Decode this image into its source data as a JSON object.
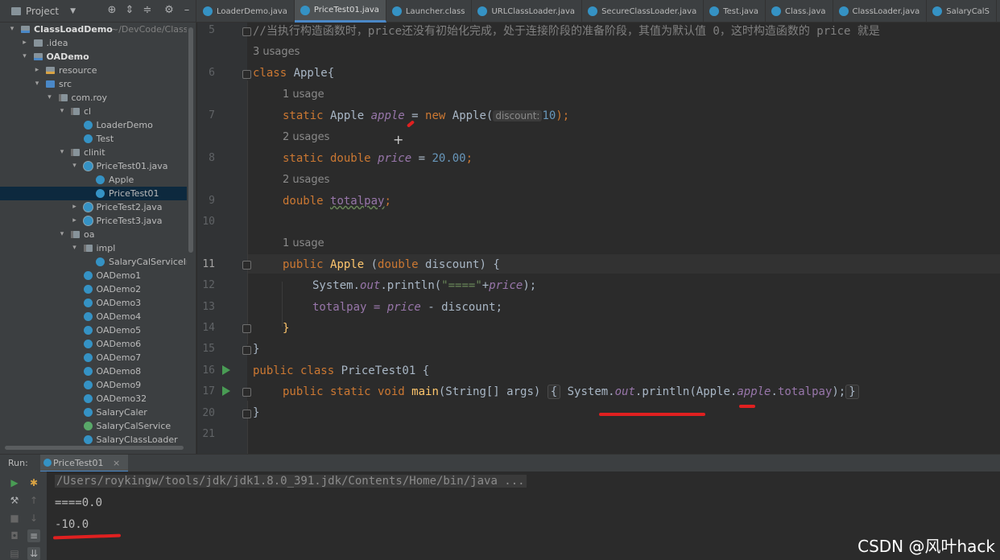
{
  "project_header": {
    "title": "Project",
    "icons": [
      "target-icon",
      "expand-icon",
      "collapse-icon",
      "gear-icon",
      "minimize-icon"
    ]
  },
  "tabs": [
    {
      "label": "LoaderDemo.java",
      "active": false
    },
    {
      "label": "PriceTest01.java",
      "active": true
    },
    {
      "label": "Launcher.class",
      "active": false
    },
    {
      "label": "URLClassLoader.java",
      "active": false
    },
    {
      "label": "SecureClassLoader.java",
      "active": false
    },
    {
      "label": "Test.java",
      "active": false
    },
    {
      "label": "Class.java",
      "active": false
    },
    {
      "label": "ClassLoader.java",
      "active": false
    },
    {
      "label": "SalaryCalS",
      "active": false
    }
  ],
  "tree": {
    "root_name": "ClassLoadDemo",
    "root_path": "~/DevCode/ClassLo",
    "items": [
      {
        "label": "ClassLoadDemo"
      },
      {
        "label": ".idea"
      },
      {
        "label": "OADemo"
      },
      {
        "label": "resource"
      },
      {
        "label": "src"
      },
      {
        "label": "com.roy"
      },
      {
        "label": "cl"
      },
      {
        "label": "LoaderDemo"
      },
      {
        "label": "Test"
      },
      {
        "label": "clinit"
      },
      {
        "label": "PriceTest01.java"
      },
      {
        "label": "Apple"
      },
      {
        "label": "PriceTest01"
      },
      {
        "label": "PriceTest2.java"
      },
      {
        "label": "PriceTest3.java"
      },
      {
        "label": "oa"
      },
      {
        "label": "impl"
      },
      {
        "label": "SalaryCalServiceIm"
      },
      {
        "label": "OADemo1"
      },
      {
        "label": "OADemo2"
      },
      {
        "label": "OADemo3"
      },
      {
        "label": "OADemo4"
      },
      {
        "label": "OADemo5"
      },
      {
        "label": "OADemo6"
      },
      {
        "label": "OADemo7"
      },
      {
        "label": "OADemo8"
      },
      {
        "label": "OADemo9"
      },
      {
        "label": "OADemo32"
      },
      {
        "label": "SalaryCaler"
      },
      {
        "label": "SalaryCalService"
      },
      {
        "label": "SalaryClassLoader"
      }
    ]
  },
  "editor": {
    "line_numbers": [
      "5",
      "6",
      "7",
      "8",
      "9",
      "10",
      "11",
      "12",
      "13",
      "14",
      "15",
      "16",
      "17",
      "20",
      "21"
    ],
    "usage_hints": [
      "3 usages",
      "1 usage",
      "2 usages",
      "2 usages",
      "1 usage"
    ],
    "comment": "//当执行构造函数时，price还没有初始化完成，处于连接阶段的准备阶段，其值为默认值 0，这时构造函数的 price 就是",
    "code": {
      "l6": {
        "kw": "class ",
        "name": "Apple{"
      },
      "l7": {
        "kw1": "static ",
        "type": "Apple ",
        "field": "apple",
        "eq": " = ",
        "kw2": "new ",
        "call": "Apple(",
        "inlay": "discount:",
        "num": "10",
        "end": ");"
      },
      "l8": {
        "kw": "static double ",
        "field": "price",
        "eq": " = ",
        "num": "20.00",
        "end": ";"
      },
      "l9": {
        "kw": "double ",
        "field": "totalpay",
        "end": ";"
      },
      "l11": {
        "kw": "public ",
        "name": "Apple",
        "p1": " (",
        "kw2": "double",
        "p2": " discount) {"
      },
      "l12": {
        "a": "System.",
        "out": "out",
        "b": ".println(",
        "str": "\"====\"",
        "c": "+",
        "field": "price",
        "d": ");"
      },
      "l13": {
        "a": "totalpay = ",
        "field": "price",
        "b": " - discount;"
      },
      "l14": {
        "brace": "}"
      },
      "l15": {
        "brace": "}"
      },
      "l16": {
        "kw": "public class ",
        "name": "PriceTest01 {"
      },
      "l17": {
        "kw": "public static void ",
        "mth": "main",
        "a": "(String[] args) ",
        "ob": "{",
        "b": " System.",
        "out": "out",
        "c": ".println(Apple.",
        "field": "apple",
        "d": ".",
        "field2": "totalpay",
        "e": ");",
        "cb": "}"
      },
      "l20": {
        "brace": "}"
      }
    }
  },
  "run": {
    "label": "Run:",
    "tab": "PriceTest01",
    "close": "×",
    "console": [
      "/Users/roykingw/tools/jdk/jdk1.8.0_391.jdk/Contents/Home/bin/java ...",
      "====0.0",
      "-10.0"
    ]
  },
  "watermark": "CSDN @风叶hack",
  "colors": {
    "keyword": "#cc7832",
    "field": "#9876aa",
    "number": "#6897bb",
    "string": "#6a8759",
    "method": "#ffc66d",
    "annotation_red": "#e02020"
  }
}
